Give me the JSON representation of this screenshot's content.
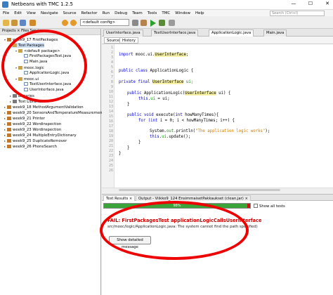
{
  "window": {
    "title": "Netbeans with TMC 1.2.5",
    "minimize": "—",
    "maximize": "☐",
    "close": "✕"
  },
  "menu": [
    "File",
    "Edit",
    "View",
    "Navigate",
    "Source",
    "Refactor",
    "Run",
    "Debug",
    "Team",
    "Tools",
    "TMC",
    "Window",
    "Help"
  ],
  "search": {
    "placeholder": "Search (Ctrl+I)"
  },
  "toolbar": {
    "config": "<default config>",
    "icons": [
      "new-project-icon",
      "open-project-icon",
      "save-icon",
      "undo-icon",
      "redo-icon",
      "build-icon",
      "clean-build-icon",
      "run-icon",
      "debug-icon",
      "profile-icon"
    ]
  },
  "projects_panel": {
    "tabs_label": "Projects × Files Services",
    "tree": [
      {
        "label": "week9_17 FirstPackages",
        "icon": "project-icon",
        "expander": "▾"
      },
      {
        "label": "Test Packages",
        "icon": "package-folder-icon",
        "expander": "▾"
      },
      {
        "label": "<default package>",
        "icon": "package-icon",
        "expander": "▾"
      },
      {
        "label": "FirstPackagesTest.java",
        "icon": "java-file-icon",
        "expander": ""
      },
      {
        "label": "Main.java",
        "icon": "java-file-icon",
        "expander": ""
      },
      {
        "label": "mooc.logic",
        "icon": "package-icon",
        "expander": "▾"
      },
      {
        "label": "ApplicationLogic.java",
        "icon": "java-file-icon",
        "expander": ""
      },
      {
        "label": "mooc.ui",
        "icon": "package-icon",
        "expander": "▾"
      },
      {
        "label": "TextUserInterface.java",
        "icon": "java-file-icon",
        "expander": ""
      },
      {
        "label": "UserInterface.java",
        "icon": "java-file-icon",
        "expander": ""
      },
      {
        "label": "Libraries",
        "icon": "library-icon",
        "expander": "▸"
      },
      {
        "label": "Test Libraries",
        "icon": "library-icon",
        "expander": "▸"
      },
      {
        "label": "week9_18 MethodArgumentValidation",
        "icon": "project-icon",
        "expander": "▸"
      },
      {
        "label": "week9_20 SensorsAndTemperatureMeasurement",
        "icon": "project-icon",
        "expander": "▸"
      },
      {
        "label": "week9_21 Printer",
        "icon": "project-icon",
        "expander": "▸"
      },
      {
        "label": "week9_22 Wordinspection",
        "icon": "project-icon",
        "expander": "▸"
      },
      {
        "label": "week9_23 Wordinspection",
        "icon": "project-icon",
        "expander": "▸"
      },
      {
        "label": "week9_24 MultipleEntryDictionary",
        "icon": "project-icon",
        "expander": "▸"
      },
      {
        "label": "week9_25 DuplicateRemover",
        "icon": "project-icon",
        "expander": "▸"
      },
      {
        "label": "week9_26 PhoneSearch",
        "icon": "project-icon",
        "expander": "▸"
      }
    ]
  },
  "editor": {
    "tabs": [
      "UserInterface.java",
      "TextUserInterface.java",
      "ApplicationLogic.java",
      "Main.java"
    ],
    "active_tab": "ApplicationLogic.java",
    "source_button": "Source",
    "history_button": "History",
    "line_numbers": [
      "1",
      "2",
      "3",
      "4",
      "5",
      "6",
      "7",
      "8",
      "9",
      "10",
      "11",
      "12",
      "13",
      "14",
      "15",
      "16",
      "17",
      "18",
      "19",
      "20",
      "21",
      "22",
      "23",
      "24",
      "25",
      "26"
    ],
    "code": {
      "import_kw": "import ",
      "import_path": "mooc.ui.",
      "import_cls": "UserInterface",
      "import_end": ";",
      "class_kw": "public class ",
      "class_name": "ApplicationLogic {",
      "field_kw": "private final ",
      "field_type": "UserInterface",
      "field_rest": " ui;",
      "ctor_kw": "public ",
      "ctor_name": "ApplicationLogic(",
      "ctor_type": "UserInterface",
      "ctor_rest": " ui) {",
      "assign_kw": "this",
      "assign_dot": ".",
      "assign_field": "ui",
      "assign_rest": " = ui;",
      "close1": "}",
      "method_kw": "public void ",
      "method_name": "execute(",
      "method_type": "int",
      "method_rest": " howManyTimes){",
      "for_kw": "for (",
      "for_type": "int",
      "for_rest": " i = 0; i < howManyTimes; i++) {",
      "print_pre": "System.",
      "print_out": "out",
      "print_mid": ".println(",
      "print_str": "\"The application logic works\"",
      "print_end": ");",
      "update_kw": "this",
      "update_dot": ".",
      "update_field": "ui",
      "update_rest": ".update();",
      "close2": "}",
      "close3": "}",
      "close4": "}"
    }
  },
  "output": {
    "tabs": [
      "Test Results ×",
      "Output - Viikko9_124 EnsimmaisetPakkaukset (clean,jar) ×"
    ],
    "progress_percent": 98,
    "progress_label": "98%",
    "show_all_tests": "Show all tests",
    "fail_title": "FAIL: FirstPackagesTest applicationLogicCallsUserInterface",
    "fail_detail": "src/mooc/logic/ApplicationLogic.java: The system cannot find the path specified)",
    "detail_button": "Show detailed message"
  },
  "colors": {
    "annotation": "#ee0000",
    "progress_pass": "#3aa33a",
    "progress_fail": "#cc1010",
    "keyword": "#0000e6"
  }
}
